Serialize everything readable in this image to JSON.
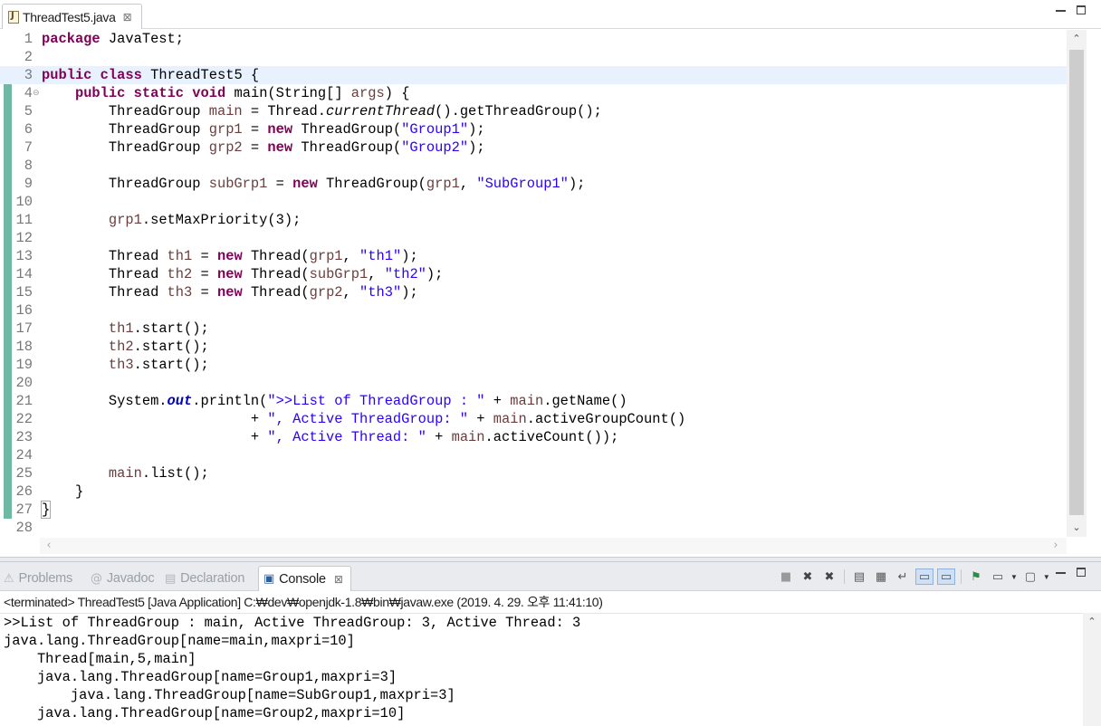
{
  "editor": {
    "tab_label": "ThreadTest5.java",
    "lines": [
      {
        "n": "1",
        "tokens": [
          [
            "kw",
            "package"
          ],
          [
            "p",
            " JavaTest;"
          ]
        ]
      },
      {
        "n": "2",
        "tokens": []
      },
      {
        "n": "3",
        "current": true,
        "tokens": [
          [
            "kw",
            "public"
          ],
          [
            "p",
            " "
          ],
          [
            "kw",
            "class"
          ],
          [
            "p",
            " ThreadTest5 {"
          ]
        ]
      },
      {
        "n": "4",
        "fold": true,
        "tokens": [
          [
            "p",
            "    "
          ],
          [
            "kw",
            "public"
          ],
          [
            "p",
            " "
          ],
          [
            "kw",
            "static"
          ],
          [
            "p",
            " "
          ],
          [
            "kw",
            "void"
          ],
          [
            "p",
            " main(String[] "
          ],
          [
            "var",
            "args"
          ],
          [
            "p",
            ") {"
          ]
        ]
      },
      {
        "n": "5",
        "tokens": [
          [
            "p",
            "        ThreadGroup "
          ],
          [
            "var",
            "main"
          ],
          [
            "p",
            " = Thread."
          ],
          [
            "sm",
            "currentThread"
          ],
          [
            "p",
            "().getThreadGroup();"
          ]
        ]
      },
      {
        "n": "6",
        "tokens": [
          [
            "p",
            "        ThreadGroup "
          ],
          [
            "var",
            "grp1"
          ],
          [
            "p",
            " = "
          ],
          [
            "kw",
            "new"
          ],
          [
            "p",
            " ThreadGroup("
          ],
          [
            "str",
            "\"Group1\""
          ],
          [
            "p",
            ");"
          ]
        ]
      },
      {
        "n": "7",
        "tokens": [
          [
            "p",
            "        ThreadGroup "
          ],
          [
            "var",
            "grp2"
          ],
          [
            "p",
            " = "
          ],
          [
            "kw",
            "new"
          ],
          [
            "p",
            " ThreadGroup("
          ],
          [
            "str",
            "\"Group2\""
          ],
          [
            "p",
            ");"
          ]
        ]
      },
      {
        "n": "8",
        "tokens": []
      },
      {
        "n": "9",
        "tokens": [
          [
            "p",
            "        ThreadGroup "
          ],
          [
            "var",
            "subGrp1"
          ],
          [
            "p",
            " = "
          ],
          [
            "kw",
            "new"
          ],
          [
            "p",
            " ThreadGroup("
          ],
          [
            "var",
            "grp1"
          ],
          [
            "p",
            ", "
          ],
          [
            "str",
            "\"SubGroup1\""
          ],
          [
            "p",
            ");"
          ]
        ]
      },
      {
        "n": "10",
        "tokens": []
      },
      {
        "n": "11",
        "tokens": [
          [
            "p",
            "        "
          ],
          [
            "var",
            "grp1"
          ],
          [
            "p",
            ".setMaxPriority(3);"
          ]
        ]
      },
      {
        "n": "12",
        "tokens": []
      },
      {
        "n": "13",
        "tokens": [
          [
            "p",
            "        Thread "
          ],
          [
            "var",
            "th1"
          ],
          [
            "p",
            " = "
          ],
          [
            "kw",
            "new"
          ],
          [
            "p",
            " Thread("
          ],
          [
            "var",
            "grp1"
          ],
          [
            "p",
            ", "
          ],
          [
            "str",
            "\"th1\""
          ],
          [
            "p",
            ");"
          ]
        ]
      },
      {
        "n": "14",
        "tokens": [
          [
            "p",
            "        Thread "
          ],
          [
            "var",
            "th2"
          ],
          [
            "p",
            " = "
          ],
          [
            "kw",
            "new"
          ],
          [
            "p",
            " Thread("
          ],
          [
            "var",
            "subGrp1"
          ],
          [
            "p",
            ", "
          ],
          [
            "str",
            "\"th2\""
          ],
          [
            "p",
            ");"
          ]
        ]
      },
      {
        "n": "15",
        "tokens": [
          [
            "p",
            "        Thread "
          ],
          [
            "var",
            "th3"
          ],
          [
            "p",
            " = "
          ],
          [
            "kw",
            "new"
          ],
          [
            "p",
            " Thread("
          ],
          [
            "var",
            "grp2"
          ],
          [
            "p",
            ", "
          ],
          [
            "str",
            "\"th3\""
          ],
          [
            "p",
            ");"
          ]
        ]
      },
      {
        "n": "16",
        "tokens": []
      },
      {
        "n": "17",
        "tokens": [
          [
            "p",
            "        "
          ],
          [
            "var",
            "th1"
          ],
          [
            "p",
            ".start();"
          ]
        ]
      },
      {
        "n": "18",
        "tokens": [
          [
            "p",
            "        "
          ],
          [
            "var",
            "th2"
          ],
          [
            "p",
            ".start();"
          ]
        ]
      },
      {
        "n": "19",
        "tokens": [
          [
            "p",
            "        "
          ],
          [
            "var",
            "th3"
          ],
          [
            "p",
            ".start();"
          ]
        ]
      },
      {
        "n": "20",
        "tokens": []
      },
      {
        "n": "21",
        "tokens": [
          [
            "p",
            "        System."
          ],
          [
            "fld",
            "out"
          ],
          [
            "p",
            ".println("
          ],
          [
            "str",
            "\">>List of ThreadGroup : \""
          ],
          [
            "p",
            " + "
          ],
          [
            "var",
            "main"
          ],
          [
            "p",
            ".getName()"
          ]
        ]
      },
      {
        "n": "22",
        "tokens": [
          [
            "p",
            "                         + "
          ],
          [
            "str",
            "\", Active ThreadGroup: \""
          ],
          [
            "p",
            " + "
          ],
          [
            "var",
            "main"
          ],
          [
            "p",
            ".activeGroupCount()"
          ]
        ]
      },
      {
        "n": "23",
        "tokens": [
          [
            "p",
            "                         + "
          ],
          [
            "str",
            "\", Active Thread: \""
          ],
          [
            "p",
            " + "
          ],
          [
            "var",
            "main"
          ],
          [
            "p",
            ".activeCount());"
          ]
        ]
      },
      {
        "n": "24",
        "tokens": []
      },
      {
        "n": "25",
        "tokens": [
          [
            "p",
            "        "
          ],
          [
            "var",
            "main"
          ],
          [
            "p",
            ".list();"
          ]
        ]
      },
      {
        "n": "26",
        "tokens": [
          [
            "p",
            "    }"
          ]
        ]
      },
      {
        "n": "27",
        "tokens": [
          [
            "box",
            "}"
          ]
        ]
      },
      {
        "n": "28",
        "tokens": []
      }
    ]
  },
  "console": {
    "tabs": [
      {
        "label": "Problems",
        "icon": "problems-icon",
        "glyph": "⚠"
      },
      {
        "label": "Javadoc",
        "icon": "javadoc-icon",
        "glyph": "@"
      },
      {
        "label": "Declaration",
        "icon": "declaration-icon",
        "glyph": "▤"
      },
      {
        "label": "Console",
        "icon": "console-icon",
        "glyph": "▣",
        "active": true
      }
    ],
    "description": "<terminated> ThreadTest5 [Java Application] C:₩dev₩openjdk-1.8₩bin₩javaw.exe (2019. 4. 29. 오후 11:41:10)",
    "output": [
      ">>List of ThreadGroup : main, Active ThreadGroup: 3, Active Thread: 3",
      "java.lang.ThreadGroup[name=main,maxpri=10]",
      "    Thread[main,5,main]",
      "    java.lang.ThreadGroup[name=Group1,maxpri=3]",
      "        java.lang.ThreadGroup[name=SubGroup1,maxpri=3]",
      "    java.lang.ThreadGroup[name=Group2,maxpri=10]"
    ],
    "toolbar": [
      {
        "name": "terminate-icon",
        "glyph": "■"
      },
      {
        "name": "remove-launch-icon",
        "glyph": "✖"
      },
      {
        "name": "remove-all-terminated-icon",
        "glyph": "✖"
      },
      {
        "sep": true
      },
      {
        "name": "clear-console-icon",
        "glyph": "▤"
      },
      {
        "name": "scroll-lock-icon",
        "glyph": "▦"
      },
      {
        "name": "word-wrap-icon",
        "glyph": "↵"
      },
      {
        "name": "show-on-stdout-icon",
        "glyph": "▭",
        "pressed": true
      },
      {
        "name": "show-on-stderr-icon",
        "glyph": "▭",
        "pressed": true
      },
      {
        "sep": true
      },
      {
        "name": "pin-console-icon",
        "glyph": "⚑"
      },
      {
        "name": "display-console-icon",
        "glyph": "▭",
        "drop": true
      },
      {
        "name": "open-console-icon",
        "glyph": "▢",
        "drop": true
      }
    ]
  }
}
